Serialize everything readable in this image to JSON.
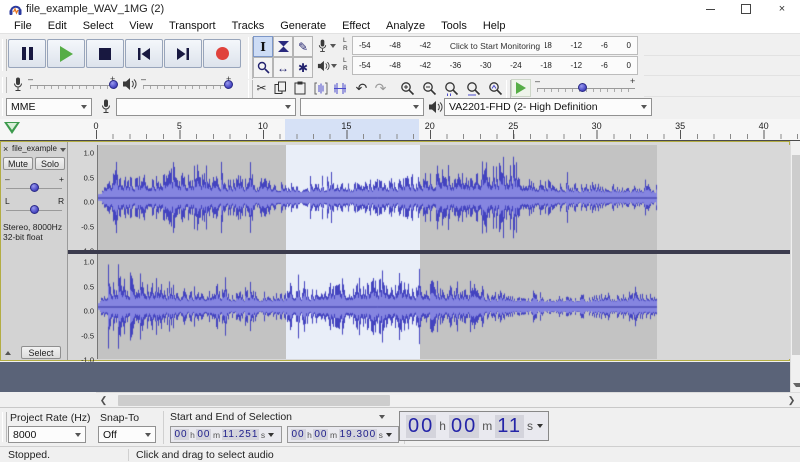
{
  "window": {
    "title": "file_example_WAV_1MG (2)",
    "close": "×"
  },
  "menu": {
    "items": [
      "File",
      "Edit",
      "Select",
      "View",
      "Transport",
      "Tracks",
      "Generate",
      "Effect",
      "Analyze",
      "Tools",
      "Help"
    ]
  },
  "glyphs": {
    "scissors": "✂",
    "pencil": "✎",
    "undo": "↶",
    "redo": "↷",
    "ibeam": "I",
    "multi": "✱",
    "arrow_lr": "↔",
    "plus": "+",
    "minus": "–",
    "scroll_left": "❮",
    "scroll_right": "❯"
  },
  "meters": {
    "ticks": [
      "-54",
      "-48",
      "-42",
      "-36",
      "-30",
      "-24",
      "-18",
      "-12",
      "-6",
      "0"
    ],
    "record": {
      "l": "L",
      "r": "R",
      "overlay": "Click to Start Monitoring"
    },
    "playback": {
      "l": "L",
      "r": "R"
    }
  },
  "device": {
    "host": "MME",
    "recording_device": "",
    "recording_channels": "",
    "playback_device": "VA2201-FHD (2- High Definition"
  },
  "timeline": {
    "labels": [
      "0",
      "5",
      "10",
      "15",
      "20",
      "25",
      "30",
      "35",
      "40"
    ],
    "seconds_per_label": 5,
    "selection_start": 11.251,
    "selection_end": 19.3,
    "audio_end": 33.5
  },
  "track": {
    "close": "×",
    "title": "file_example",
    "mute": "Mute",
    "solo": "Solo",
    "gain_min": "–",
    "gain_max": "+",
    "pan_left": "L",
    "pan_right": "R",
    "info": [
      "Stereo, 8000Hz",
      "32-bit float"
    ],
    "select_button": "Select",
    "vruler": [
      "1.0",
      "0.5",
      "0.0",
      "-0.5",
      "-1.0"
    ]
  },
  "selection_bar": {
    "project_rate_label": "Project Rate (Hz)",
    "project_rate": "8000",
    "snap_label": "Snap-To",
    "snap": "Off",
    "mode": "Start and End of Selection",
    "start_parts": [
      "00",
      "h",
      "00",
      "m",
      "11.251",
      "s"
    ],
    "end_parts": [
      "00",
      "h",
      "00",
      "m",
      "19.300",
      "s"
    ]
  },
  "position_display": {
    "parts": [
      "00",
      "h",
      "00",
      "m",
      "11",
      "s"
    ]
  },
  "status": {
    "state": "Stopped.",
    "message": "Click and drag to select audio"
  },
  "colors": {
    "wave_peak": "#4343bf",
    "wave_rms": "#8585e0",
    "wave_center": "#30309e"
  }
}
